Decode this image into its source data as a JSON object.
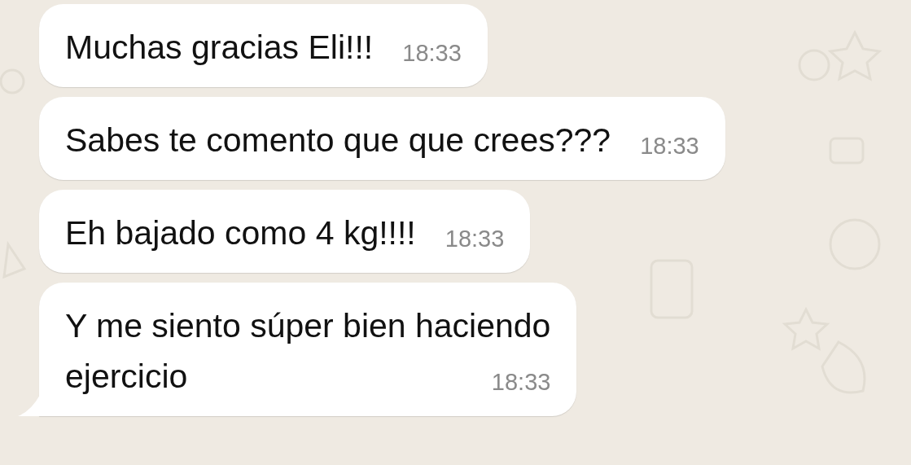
{
  "messages": [
    {
      "text": "Muchas gracias Eli!!!",
      "time": "18:33",
      "tail": false
    },
    {
      "text": "Sabes te comento que que crees???",
      "time": "18:33",
      "tail": false
    },
    {
      "text": "Eh bajado como 4 kg!!!!",
      "time": "18:33",
      "tail": false
    },
    {
      "text": "Y me siento súper bien haciendo\nejercicio",
      "time": "18:33",
      "tail": true
    }
  ]
}
